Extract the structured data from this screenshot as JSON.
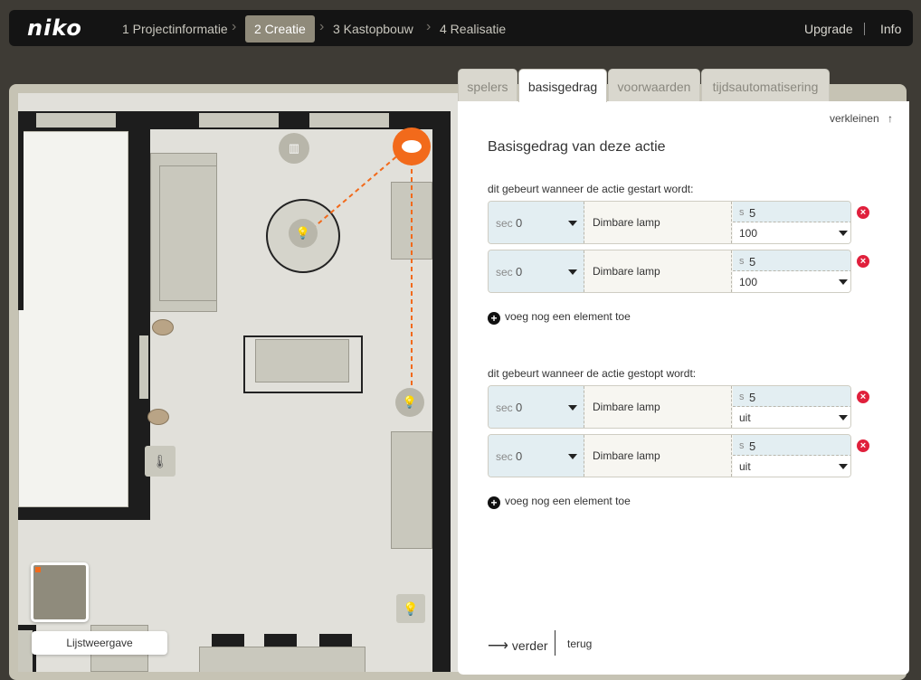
{
  "nav": {
    "logo": "niko",
    "steps": [
      "1 Projectinformatie",
      "2 Creatie",
      "3 Kastopbouw",
      "4 Realisatie"
    ],
    "active_step": 1,
    "upgrade": "Upgrade",
    "info": "Info"
  },
  "tabs": [
    "spelers",
    "basisgedrag",
    "voorwaarden",
    "tijdsautomatisering"
  ],
  "active_tab": "basisgedrag",
  "panel": {
    "collapse_label": "verkleinen",
    "title": "Basisgedrag van deze actie",
    "start_label": "dit gebeurt wanneer de actie gestart wordt:",
    "stop_label": "dit gebeurt wanneer de actie gestopt wordt:",
    "add_label": "voeg nog een element toe",
    "start_rows": [
      {
        "sec_unit": "sec",
        "sec_value": "0",
        "device": "Dimbare lamp",
        "s_unit": "s",
        "s_value": "5",
        "level": "100"
      },
      {
        "sec_unit": "sec",
        "sec_value": "0",
        "device": "Dimbare lamp",
        "s_unit": "s",
        "s_value": "5",
        "level": "100"
      }
    ],
    "stop_rows": [
      {
        "sec_unit": "sec",
        "sec_value": "0",
        "device": "Dimbare lamp",
        "s_unit": "s",
        "s_value": "5",
        "level": "uit"
      },
      {
        "sec_unit": "sec",
        "sec_value": "0",
        "device": "Dimbare lamp",
        "s_unit": "s",
        "s_value": "5",
        "level": "uit"
      }
    ],
    "next_label": "verder",
    "back_label": "terug"
  },
  "plan": {
    "list_view_label": "Lijstweergave"
  },
  "colors": {
    "accent": "#f26a1b",
    "delete": "#e0203c",
    "topbar": "#141414"
  }
}
